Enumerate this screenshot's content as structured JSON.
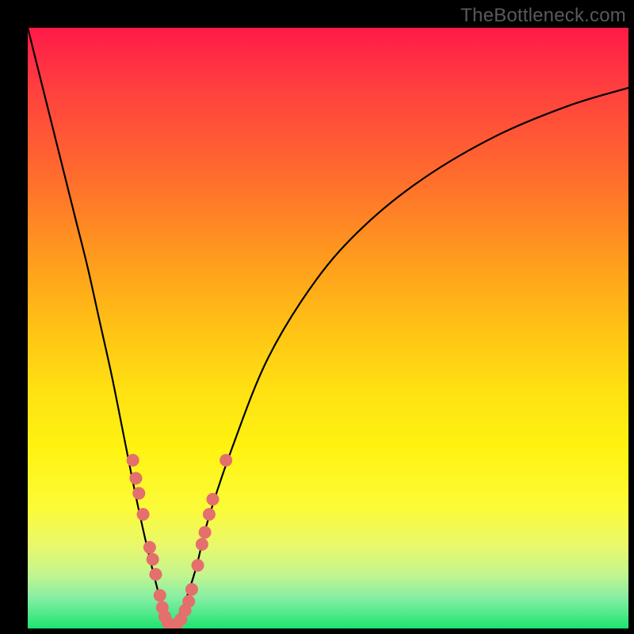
{
  "watermark": {
    "text": "TheBottleneck.com"
  },
  "chart_data": {
    "type": "line",
    "title": "",
    "xlabel": "",
    "ylabel": "",
    "xlim": [
      0,
      100
    ],
    "ylim": [
      0,
      100
    ],
    "background_gradient": {
      "top_color": "#ff1a49",
      "bottom_color": "#1de470"
    },
    "optimum_x": 24,
    "series": [
      {
        "name": "left-branch",
        "x": [
          0,
          2,
          4,
          6,
          8,
          10,
          12,
          14,
          16,
          18,
          20,
          22,
          23,
          24
        ],
        "values": [
          100,
          92,
          84,
          76,
          68,
          60,
          51,
          42,
          32,
          22,
          13,
          5,
          1.5,
          0
        ]
      },
      {
        "name": "right-branch",
        "x": [
          24,
          26,
          28,
          30,
          34,
          40,
          48,
          56,
          66,
          78,
          90,
          100
        ],
        "values": [
          0,
          4,
          10,
          18,
          30,
          45,
          58,
          67,
          75,
          82,
          87,
          90
        ]
      }
    ],
    "scatter": {
      "name": "data-points",
      "color": "#e46f6c",
      "radius": 8,
      "points": [
        {
          "x": 17.5,
          "y": 28
        },
        {
          "x": 18.0,
          "y": 25
        },
        {
          "x": 18.5,
          "y": 22.5
        },
        {
          "x": 19.2,
          "y": 19
        },
        {
          "x": 20.3,
          "y": 13.5
        },
        {
          "x": 20.8,
          "y": 11.5
        },
        {
          "x": 21.3,
          "y": 9
        },
        {
          "x": 22.0,
          "y": 5.5
        },
        {
          "x": 22.4,
          "y": 3.5
        },
        {
          "x": 22.8,
          "y": 2
        },
        {
          "x": 23.3,
          "y": 1
        },
        {
          "x": 24.0,
          "y": 0.5
        },
        {
          "x": 24.8,
          "y": 0.7
        },
        {
          "x": 25.5,
          "y": 1.5
        },
        {
          "x": 26.2,
          "y": 3
        },
        {
          "x": 26.8,
          "y": 4.5
        },
        {
          "x": 27.3,
          "y": 6.5
        },
        {
          "x": 28.3,
          "y": 10.5
        },
        {
          "x": 29.0,
          "y": 14
        },
        {
          "x": 29.5,
          "y": 16
        },
        {
          "x": 30.2,
          "y": 19
        },
        {
          "x": 30.8,
          "y": 21.5
        },
        {
          "x": 33.0,
          "y": 28
        }
      ]
    }
  }
}
